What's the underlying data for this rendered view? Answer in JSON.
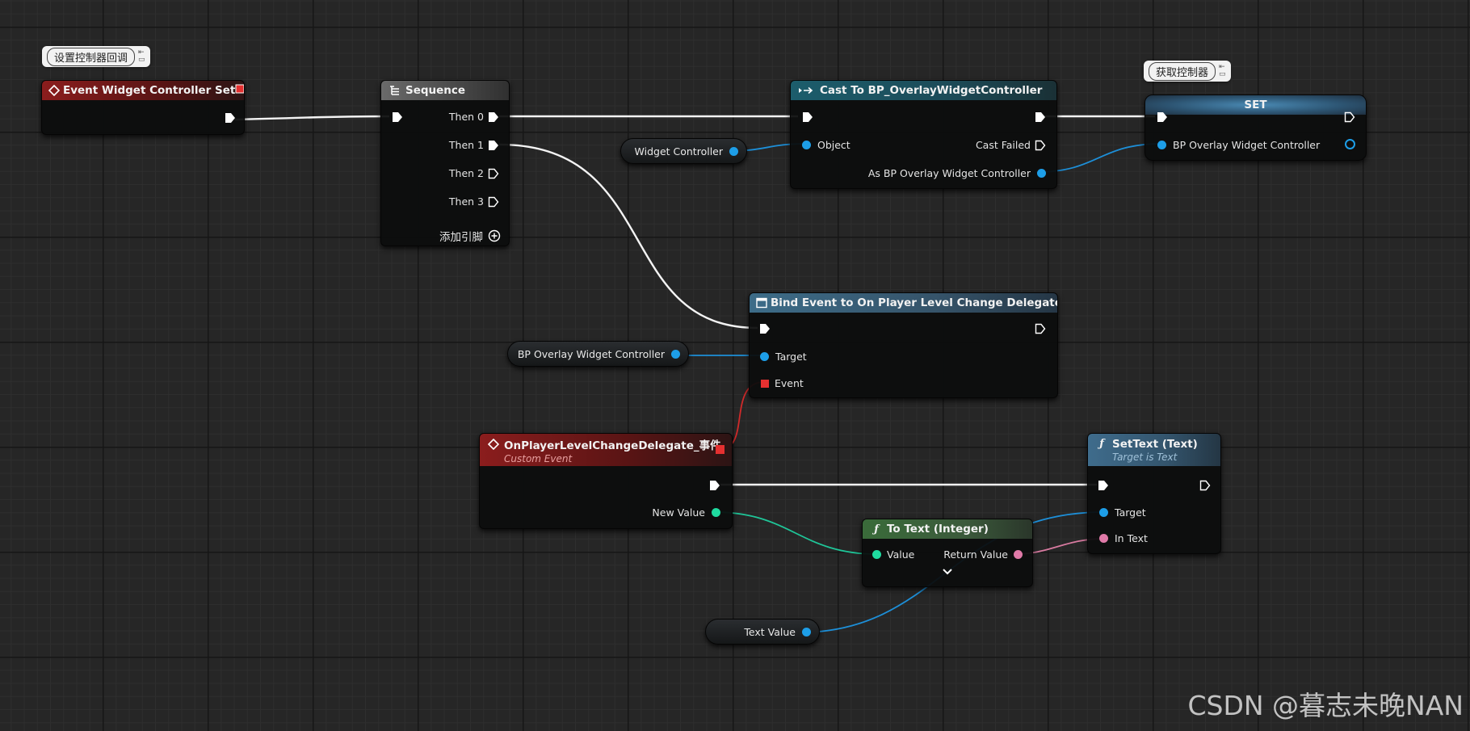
{
  "comments": {
    "controller_set": "设置控制器回调",
    "get_controller": "获取控制器"
  },
  "nodes": {
    "event_widget_controller_set": {
      "title": "Event Widget Controller Set"
    },
    "sequence": {
      "title": "Sequence",
      "pins": [
        "Then 0",
        "Then 1",
        "Then 2",
        "Then 3"
      ],
      "add_pin": "添加引脚"
    },
    "cast": {
      "title": "Cast To BP_OverlayWidgetController",
      "object_pin": "Object",
      "cast_failed": "Cast Failed",
      "as_pin": "As BP Overlay Widget Controller"
    },
    "set": {
      "title": "SET",
      "pin": "BP Overlay Widget Controller"
    },
    "bind_event": {
      "title": "Bind Event to On Player Level Change Delegate",
      "target": "Target",
      "event": "Event"
    },
    "custom_event": {
      "title": "OnPlayerLevelChangeDelegate_事件",
      "subtitle": "Custom Event",
      "new_value": "New Value"
    },
    "set_text": {
      "title": "SetText (Text)",
      "subtitle": "Target is Text",
      "target": "Target",
      "in_text": "In Text"
    },
    "to_text": {
      "title": "To Text (Integer)",
      "value": "Value",
      "return_value": "Return Value"
    }
  },
  "variables": {
    "widget_controller": "Widget Controller",
    "bp_overlay_widget_controller": "BP Overlay Widget Controller",
    "text_value": "Text Value"
  },
  "watermark": "CSDN @暮志未晚NAN",
  "colors": {
    "exec_wire": "#ffffff",
    "object_pin": "#1d9ee8",
    "delegate_pin": "#e53030",
    "int_pin": "#1fdba0",
    "text_pin": "#e07aa8"
  }
}
